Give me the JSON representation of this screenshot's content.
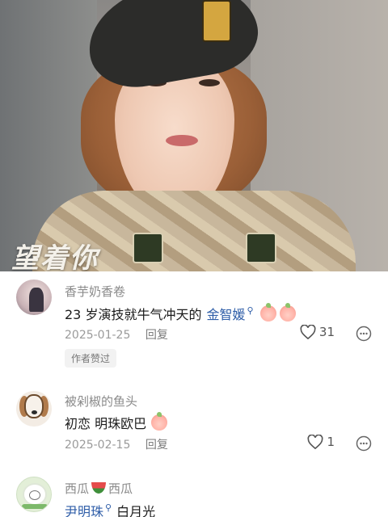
{
  "video": {
    "caption": "望着你"
  },
  "comments": [
    {
      "username": "香芋奶香卷",
      "text": "23 岁演技就牛气冲天的",
      "mention": "金智媛",
      "date": "2025-01-25",
      "reply_label": "回复",
      "likes": "31",
      "tag": "作者赞过"
    },
    {
      "username": "被剁椒的鱼头",
      "text": "初恋 明珠欧巴",
      "date": "2025-02-15",
      "reply_label": "回复",
      "likes": "1"
    },
    {
      "username_prefix": "西瓜",
      "username_suffix": "西瓜",
      "mention": "尹明珠",
      "text": "白月光"
    }
  ],
  "icons": {
    "like": "heart-outline-icon",
    "more": "more-options-icon",
    "mention": "search-mention-icon"
  }
}
